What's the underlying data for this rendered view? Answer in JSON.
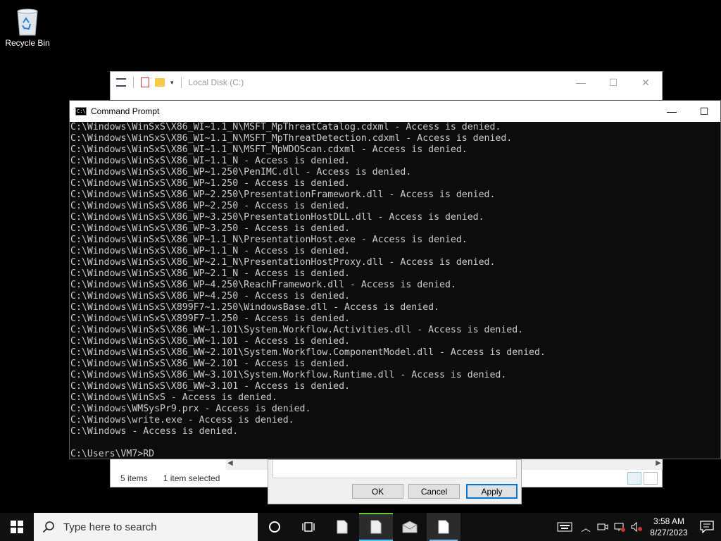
{
  "desktop": {
    "recycle_bin_label": "Recycle Bin"
  },
  "explorer": {
    "title": "Local Disk (C:)",
    "status_items": "5 items",
    "status_selected": "1 item selected"
  },
  "properties_dialog": {
    "ok_label": "OK",
    "cancel_label": "Cancel",
    "apply_label": "Apply"
  },
  "cmd": {
    "title": "Command Prompt",
    "lines": [
      "C:\\Windows\\WinSxS\\X86_WI~1.1_N\\MSFT_MpThreatCatalog.cdxml - Access is denied.",
      "C:\\Windows\\WinSxS\\X86_WI~1.1_N\\MSFT_MpThreatDetection.cdxml - Access is denied.",
      "C:\\Windows\\WinSxS\\X86_WI~1.1_N\\MSFT_MpWDOScan.cdxml - Access is denied.",
      "C:\\Windows\\WinSxS\\X86_WI~1.1_N - Access is denied.",
      "C:\\Windows\\WinSxS\\X86_WP~1.250\\PenIMC.dll - Access is denied.",
      "C:\\Windows\\WinSxS\\X86_WP~1.250 - Access is denied.",
      "C:\\Windows\\WinSxS\\X86_WP~2.250\\PresentationFramework.dll - Access is denied.",
      "C:\\Windows\\WinSxS\\X86_WP~2.250 - Access is denied.",
      "C:\\Windows\\WinSxS\\X86_WP~3.250\\PresentationHostDLL.dll - Access is denied.",
      "C:\\Windows\\WinSxS\\X86_WP~3.250 - Access is denied.",
      "C:\\Windows\\WinSxS\\X86_WP~1.1_N\\PresentationHost.exe - Access is denied.",
      "C:\\Windows\\WinSxS\\X86_WP~1.1_N - Access is denied.",
      "C:\\Windows\\WinSxS\\X86_WP~2.1_N\\PresentationHostProxy.dll - Access is denied.",
      "C:\\Windows\\WinSxS\\X86_WP~2.1_N - Access is denied.",
      "C:\\Windows\\WinSxS\\X86_WP~4.250\\ReachFramework.dll - Access is denied.",
      "C:\\Windows\\WinSxS\\X86_WP~4.250 - Access is denied.",
      "C:\\Windows\\WinSxS\\X899F7~1.250\\WindowsBase.dll - Access is denied.",
      "C:\\Windows\\WinSxS\\X899F7~1.250 - Access is denied.",
      "C:\\Windows\\WinSxS\\X86_WW~1.101\\System.Workflow.Activities.dll - Access is denied.",
      "C:\\Windows\\WinSxS\\X86_WW~1.101 - Access is denied.",
      "C:\\Windows\\WinSxS\\X86_WW~2.101\\System.Workflow.ComponentModel.dll - Access is denied.",
      "C:\\Windows\\WinSxS\\X86_WW~2.101 - Access is denied.",
      "C:\\Windows\\WinSxS\\X86_WW~3.101\\System.Workflow.Runtime.dll - Access is denied.",
      "C:\\Windows\\WinSxS\\X86_WW~3.101 - Access is denied.",
      "C:\\Windows\\WinSxS - Access is denied.",
      "C:\\Windows\\WMSysPr9.prx - Access is denied.",
      "C:\\Windows\\write.exe - Access is denied.",
      "C:\\Windows - Access is denied.",
      "",
      "C:\\Users\\VM7>RD"
    ]
  },
  "taskbar": {
    "search_placeholder": "Type here to search",
    "time": "3:58 AM",
    "date": "8/27/2023"
  },
  "colors": {
    "accent": "#0078d7",
    "console_bg": "#0c0c0c",
    "console_text": "#cccccc"
  },
  "icons": [
    "recycle-bin-icon",
    "windows-start-icon",
    "search-icon",
    "cortana-icon",
    "task-view-icon",
    "file-icon",
    "mail-icon",
    "network-icon",
    "volume-icon",
    "notification-icon"
  ]
}
